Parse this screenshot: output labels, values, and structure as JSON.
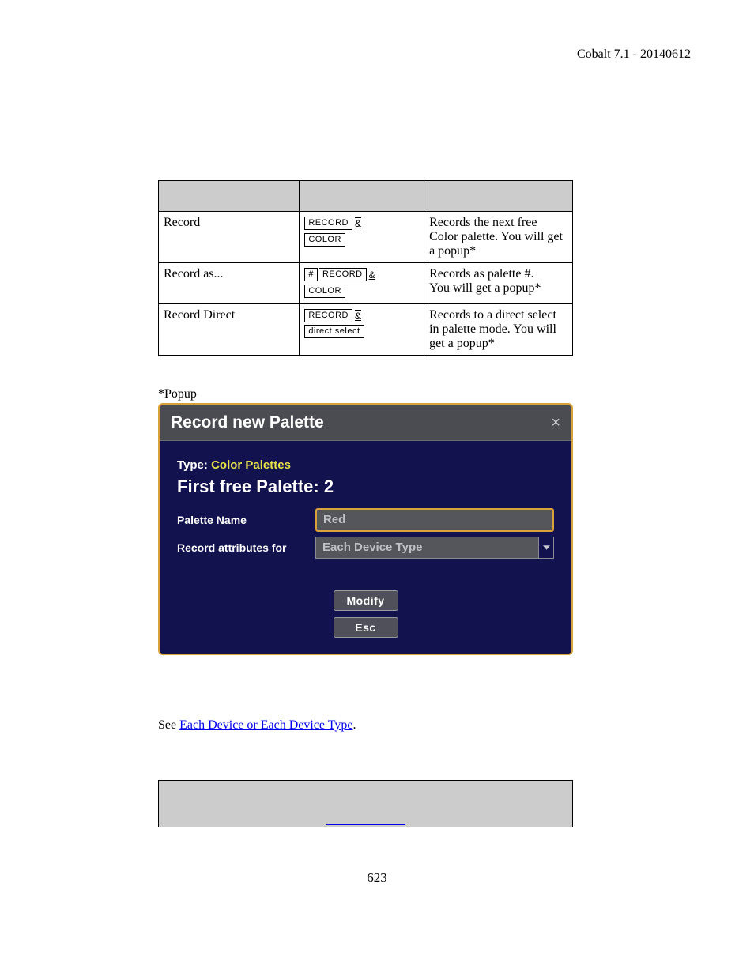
{
  "header": {
    "right": "Cobalt 7.1 - 20140612"
  },
  "table": {
    "rows": [
      {
        "name": "Record",
        "keys": [
          [
            "RECORD",
            "&"
          ],
          [
            "COLOR"
          ]
        ],
        "desc": "Records the next free Color palette. You will get a popup*"
      },
      {
        "name": "Record as...",
        "keys": [
          [
            "#",
            "RECORD",
            "&"
          ],
          [
            "COLOR"
          ]
        ],
        "desc": "Records as palette #.\nYou will get a popup*"
      },
      {
        "name": "Record Direct",
        "keys": [
          [
            "RECORD",
            "&"
          ],
          [
            "direct select"
          ]
        ],
        "desc": "Records to a direct select in palette mode. You will get a popup*"
      }
    ]
  },
  "popupLabel": "*Popup",
  "dialog": {
    "title": "Record new Palette",
    "typeLabel": "Type:",
    "typeValue": "Color Palettes",
    "headline": "First free Palette: 2",
    "fields": {
      "nameLabel": "Palette Name",
      "nameValue": "Red",
      "attrLabel": "Record attributes for",
      "attrValue": "Each Device Type"
    },
    "buttons": {
      "modify": "Modify",
      "esc": "Esc"
    }
  },
  "see": {
    "prefix": "See ",
    "link": "Each Device or Each Device Type",
    "suffix": "."
  },
  "pageNumber": "623"
}
